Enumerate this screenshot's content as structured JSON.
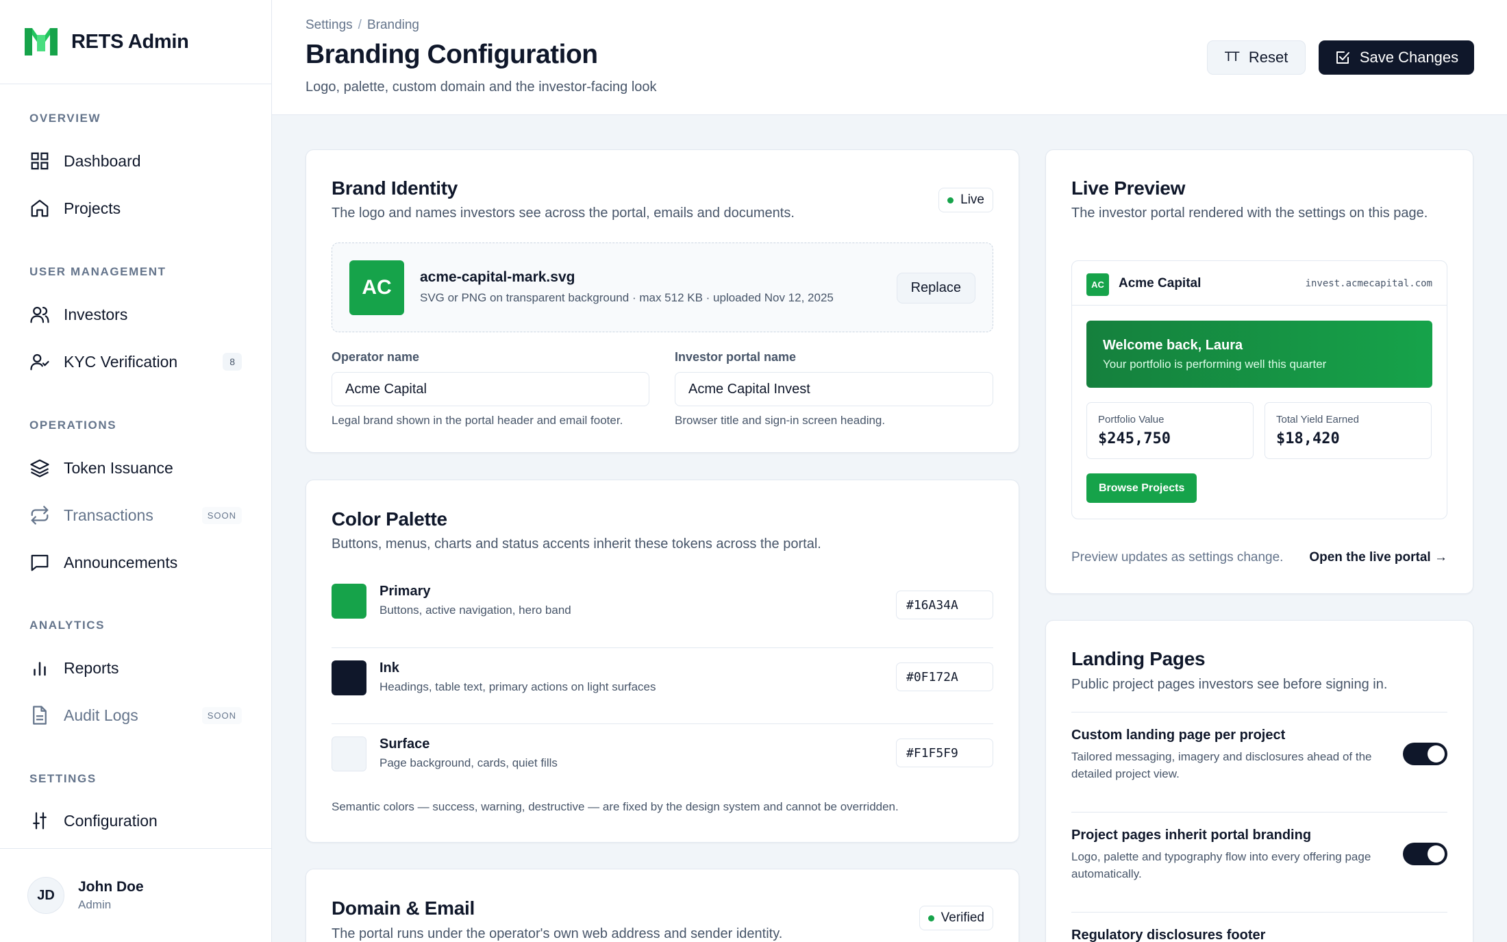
{
  "app": {
    "name": "RETS Admin"
  },
  "sidebar": {
    "sections": [
      {
        "label": "OVERVIEW"
      },
      {
        "label": "USER MANAGEMENT"
      },
      {
        "label": "OPERATIONS"
      },
      {
        "label": "ANALYTICS"
      },
      {
        "label": "SETTINGS"
      }
    ],
    "items": [
      {
        "label": "Dashboard",
        "icon": "grid-icon"
      },
      {
        "label": "Projects",
        "icon": "home-icon"
      },
      {
        "label": "Investors",
        "icon": "users-icon"
      },
      {
        "label": "KYC Verification",
        "icon": "user-check-icon",
        "badge": "8"
      },
      {
        "label": "Token Issuance",
        "icon": "layers-icon"
      },
      {
        "label": "Transactions",
        "icon": "repeat-icon",
        "tag": "SOON"
      },
      {
        "label": "Announcements",
        "icon": "message-icon"
      },
      {
        "label": "Reports",
        "icon": "bar-chart-icon"
      },
      {
        "label": "Audit Logs",
        "icon": "file-text-icon",
        "tag": "SOON"
      },
      {
        "label": "Configuration",
        "icon": "sliders-icon"
      }
    ],
    "user": {
      "initials": "JD",
      "name": "John Doe",
      "role": "Admin"
    }
  },
  "header": {
    "breadcrumb": [
      "Settings",
      "Branding"
    ],
    "breadcrumb_sep": "/",
    "title": "Branding Configuration",
    "subtitle": "Logo, palette, custom domain and the investor-facing look",
    "reset_icon": "TT",
    "reset_label": "Reset",
    "save_label": "Save Changes"
  },
  "brand_identity": {
    "title": "Brand Identity",
    "desc": "The logo and names investors see across the portal, emails and documents.",
    "status": "Live",
    "logo": {
      "initials": "AC",
      "file_name": "acme-capital-mark.svg",
      "meta": "SVG or PNG on transparent background · max 512 KB · uploaded Nov 12, 2025",
      "replace_label": "Replace"
    },
    "operator": {
      "label": "Operator name",
      "value": "Acme Capital",
      "hint": "Legal brand shown in the portal header and email footer."
    },
    "portal": {
      "label": "Investor portal name",
      "value": "Acme Capital Invest",
      "hint": "Browser title and sign-in screen heading."
    }
  },
  "palette": {
    "title": "Color Palette",
    "desc": "Buttons, menus, charts and status accents inherit these tokens across the portal.",
    "colors": [
      {
        "name": "Primary",
        "desc": "Buttons, active navigation, hero band",
        "hex": "#16A34A"
      },
      {
        "name": "Ink",
        "desc": "Headings, table text, primary actions on light surfaces",
        "hex": "#0F172A"
      },
      {
        "name": "Surface",
        "desc": "Page background, cards, quiet fills",
        "hex": "#F1F5F9"
      }
    ],
    "note": "Semantic colors — success, warning, destructive — are fixed by the design system and cannot be overridden."
  },
  "domain": {
    "title": "Domain & Email",
    "desc": "The portal runs under the operator's own web address and sender identity.",
    "status": "Verified"
  },
  "preview": {
    "title": "Live Preview",
    "desc": "The investor portal rendered with the settings on this page.",
    "logo_initials": "AC",
    "brand": "Acme Capital",
    "domain": "invest.acmecapital.com",
    "hero_title": "Welcome back, Laura",
    "hero_sub": "Your portfolio is performing well this quarter",
    "stats": [
      {
        "label": "Portfolio Value",
        "value": "$245,750"
      },
      {
        "label": "Total Yield Earned",
        "value": "$18,420"
      }
    ],
    "cta": "Browse Projects",
    "footer_note": "Preview updates as settings change.",
    "open_link": "Open the live portal →"
  },
  "landing": {
    "title": "Landing Pages",
    "desc": "Public project pages investors see before signing in.",
    "options": [
      {
        "title": "Custom landing page per project",
        "desc": "Tailored messaging, imagery and disclosures ahead of the detailed project view.",
        "enabled": true
      },
      {
        "title": "Project pages inherit portal branding",
        "desc": "Logo, palette and typography flow into every offering page automatically.",
        "enabled": true
      },
      {
        "title": "Regulatory disclosures footer"
      }
    ]
  }
}
